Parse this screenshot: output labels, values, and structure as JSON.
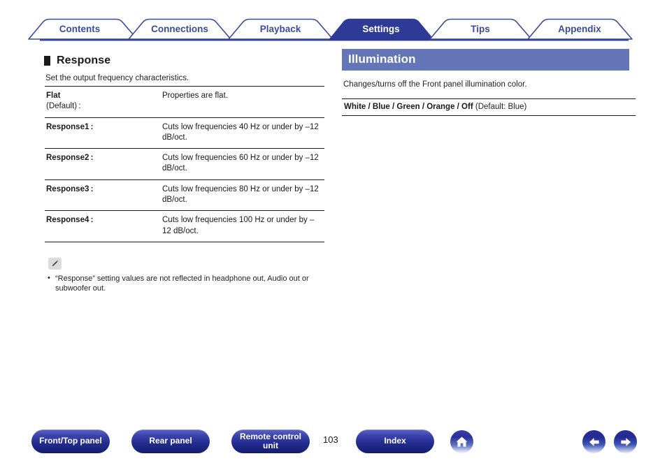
{
  "tabs": [
    {
      "label": "Contents",
      "active": false
    },
    {
      "label": "Connections",
      "active": false
    },
    {
      "label": "Playback",
      "active": false
    },
    {
      "label": "Settings",
      "active": true
    },
    {
      "label": "Tips",
      "active": false
    },
    {
      "label": "Appendix",
      "active": false
    }
  ],
  "colors": {
    "tab_border": "#3b4b9c",
    "tab_active_bg": "#2e3b96",
    "tab_text": "#3b4b9c",
    "tab_active_text": "#ffffff",
    "section_bar_bg": "#6476b8",
    "rule": "#1a1a1a"
  },
  "left": {
    "heading": "Response",
    "heading_bullet_icon": "black-square-bullet",
    "intro": "Set the output frequency characteristics.",
    "table": {
      "rows": [
        {
          "key": "Flat",
          "key_sub": "(Default) :",
          "value": "Properties are flat."
        },
        {
          "key": "Response1 :",
          "key_sub": "",
          "value": "Cuts low frequencies 40 Hz or under by –12 dB/oct."
        },
        {
          "key": "Response2 :",
          "key_sub": "",
          "value": "Cuts low frequencies 60 Hz or under by –12 dB/oct."
        },
        {
          "key": "Response3 :",
          "key_sub": "",
          "value": "Cuts low frequencies 80 Hz or under by –12 dB/oct."
        },
        {
          "key": "Response4 :",
          "key_sub": "",
          "value": "Cuts low frequencies 100 Hz or under by –12 dB/oct."
        }
      ]
    },
    "note": {
      "icon": "pencil-icon",
      "items": [
        "“Response” setting values are not reflected in headphone out, Audio out or subwoofer out."
      ]
    }
  },
  "right": {
    "heading": "Illumination",
    "description": "Changes/turns off the Front panel illumination color.",
    "values_bold": "White / Blue / Green / Orange / Off",
    "values_default": "(Default: Blue)"
  },
  "footer": {
    "buttons": [
      {
        "label": "Front/Top panel",
        "name": "front-top-panel-button"
      },
      {
        "label": "Rear panel",
        "name": "rear-panel-button"
      },
      {
        "label": "Remote control unit",
        "name": "remote-control-unit-button"
      },
      {
        "label": "Index",
        "name": "index-button"
      }
    ],
    "page_number": "103",
    "home_icon": "home-icon",
    "prev_icon": "arrow-left-icon",
    "next_icon": "arrow-right-icon"
  }
}
